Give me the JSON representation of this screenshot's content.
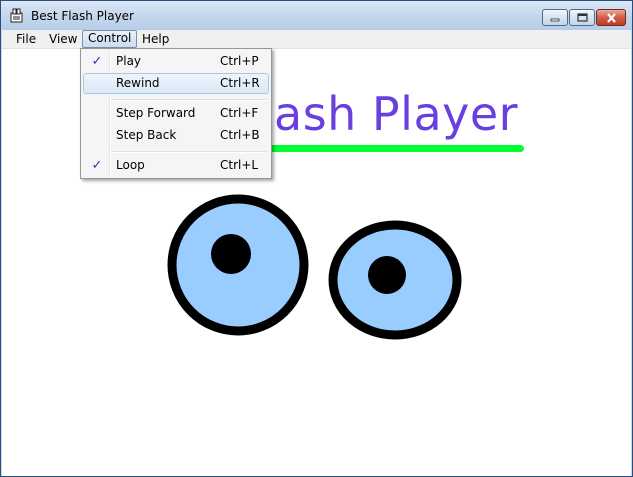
{
  "window": {
    "title": "Best Flash Player"
  },
  "menubar": {
    "items": [
      "File",
      "View",
      "Control",
      "Help"
    ]
  },
  "control_menu": {
    "items": [
      {
        "label": "Play",
        "shortcut": "Ctrl+P",
        "checked": true
      },
      {
        "label": "Rewind",
        "shortcut": "Ctrl+R",
        "checked": false
      },
      {
        "label": "Step Forward",
        "shortcut": "Ctrl+F",
        "checked": false
      },
      {
        "label": "Step Back",
        "shortcut": "Ctrl+B",
        "checked": false
      },
      {
        "label": "Loop",
        "shortcut": "Ctrl+L",
        "checked": true
      }
    ],
    "check_glyph": "✓"
  },
  "stage": {
    "title_text": "ash Player"
  },
  "colors": {
    "title": "#6a3fe0",
    "underline": "#00ff33",
    "eye_fill": "#99ccff",
    "eye_outline": "#000000"
  }
}
